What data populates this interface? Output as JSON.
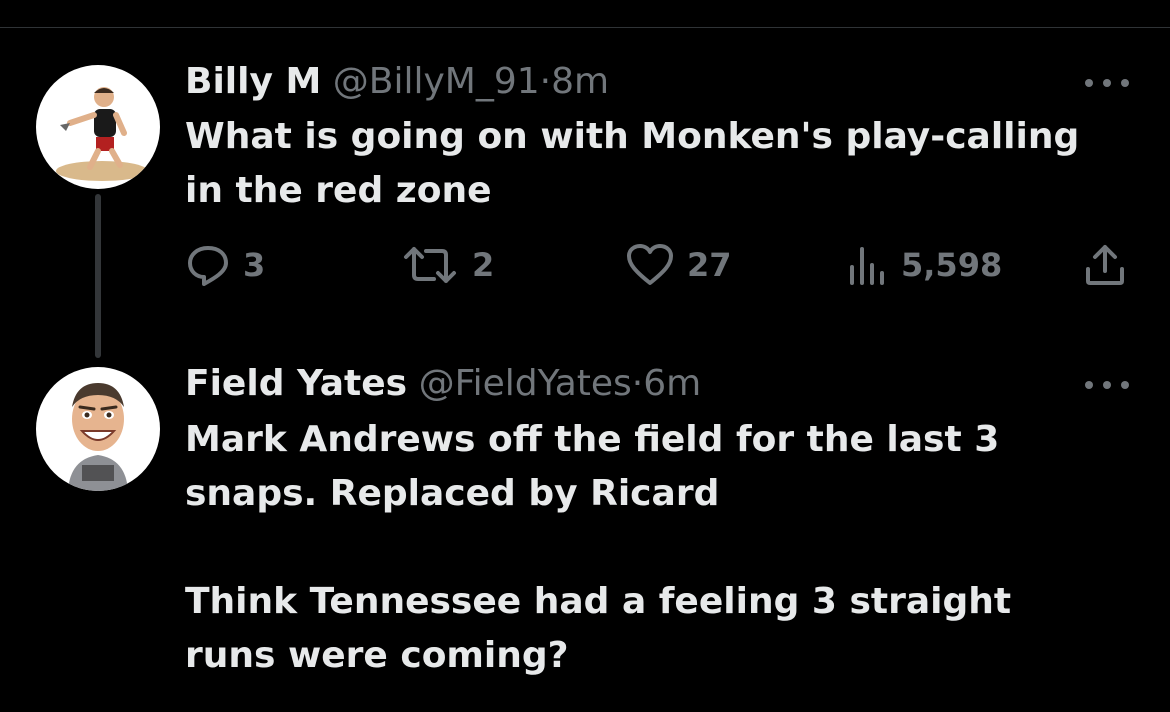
{
  "tweets": [
    {
      "name": "Billy M",
      "handle": "@BillyM_91",
      "separator": "·",
      "time": "8m",
      "text_lines": [
        "What is going on with Monken's play-calling",
        "in the red zone"
      ],
      "stats": {
        "replies": "3",
        "retweets": "2",
        "likes": "27",
        "views": "5,598"
      }
    },
    {
      "name": "Field Yates",
      "handle": "@FieldYates",
      "separator": "·",
      "time": "6m",
      "paragraph1": [
        "Mark Andrews off the field for the last 3",
        "snaps. Replaced by Ricard"
      ],
      "paragraph2": [
        "Think Tennessee had a feeling 3 straight",
        "runs were coming?"
      ]
    }
  ],
  "icons": {
    "reply": "reply-icon",
    "retweet": "retweet-icon",
    "like": "heart-icon",
    "views": "views-icon",
    "share": "share-icon",
    "more": "more-icon"
  },
  "colors": {
    "background": "#000000",
    "text": "#e7e9ea",
    "muted": "#71767b"
  }
}
